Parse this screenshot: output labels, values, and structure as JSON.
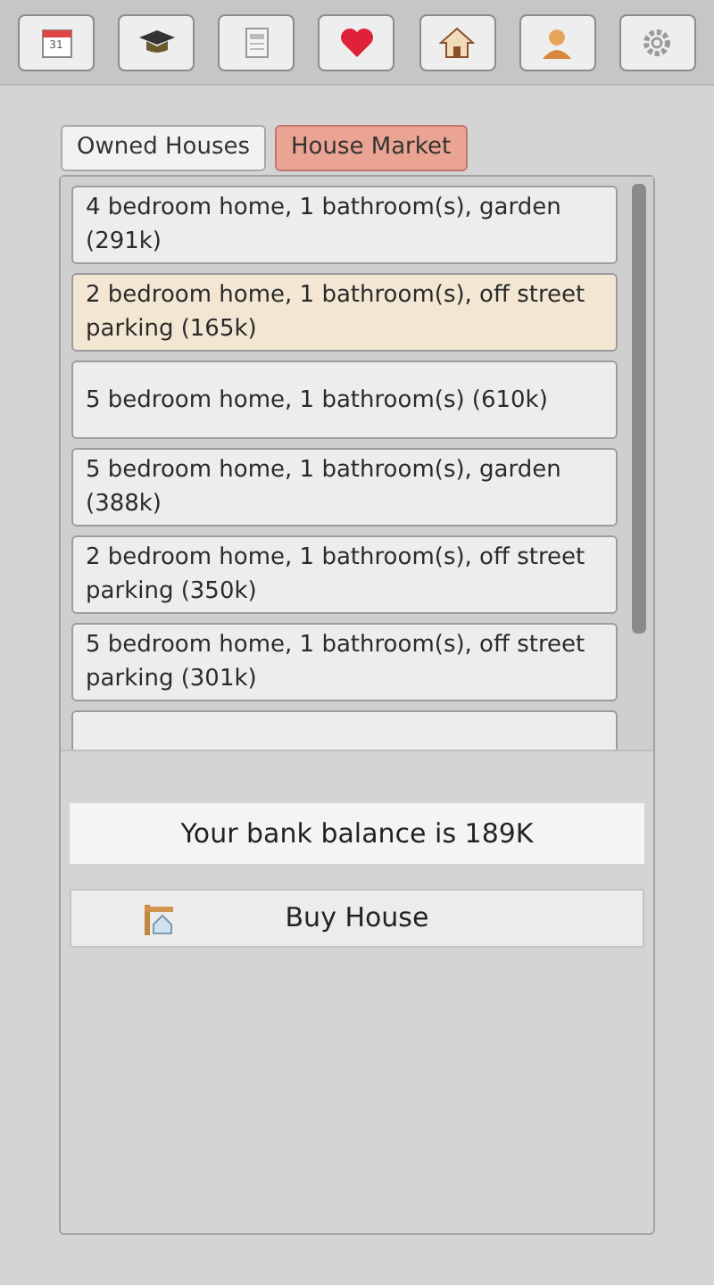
{
  "toolbar": [
    {
      "kind": "calendar",
      "label": "31",
      "selected": false
    },
    {
      "kind": "cap",
      "selected": false
    },
    {
      "kind": "newspaper",
      "selected": false
    },
    {
      "kind": "heart",
      "selected": false
    },
    {
      "kind": "house",
      "selected": false
    },
    {
      "kind": "person",
      "selected": false
    },
    {
      "kind": "gear",
      "selected": false
    }
  ],
  "tabs": [
    {
      "label": "Owned Houses",
      "selected": false
    },
    {
      "label": "House Market",
      "selected": true
    }
  ],
  "houses": [
    {
      "label": "4 bedroom home, 1 bathroom(s), garden (291k)",
      "selected": false
    },
    {
      "label": "2 bedroom home, 1 bathroom(s), off street parking (165k)",
      "selected": true
    },
    {
      "label": "5 bedroom home, 1 bathroom(s) (610k)",
      "selected": false
    },
    {
      "label": "5 bedroom home, 1 bathroom(s), garden (388k)",
      "selected": false
    },
    {
      "label": "2 bedroom home, 1 bathroom(s), off street parking (350k)",
      "selected": false
    },
    {
      "label": "5 bedroom home, 1 bathroom(s), off street parking (301k)",
      "selected": false
    }
  ],
  "balance": "Your bank balance is 189K",
  "buy_button": {
    "label": "Buy House"
  }
}
